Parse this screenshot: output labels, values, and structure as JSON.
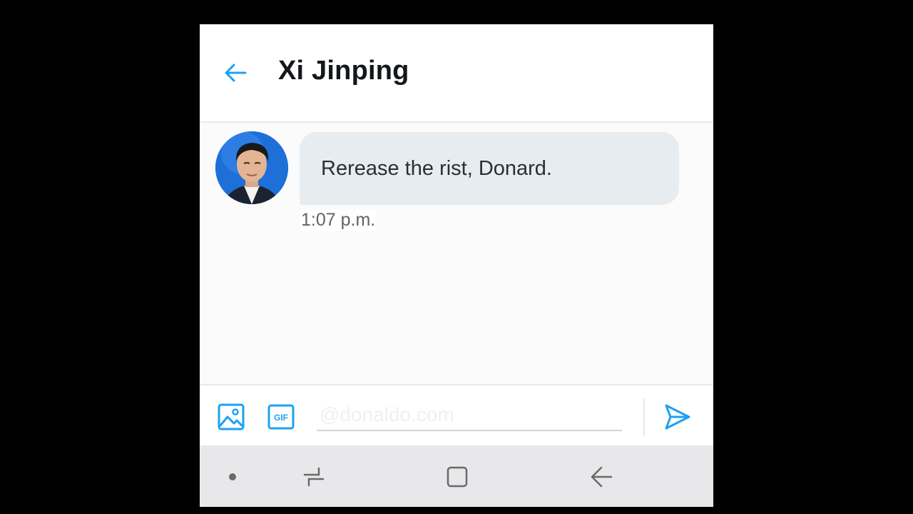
{
  "header": {
    "title": "Xi Jinping",
    "back_icon": "arrow-left-icon"
  },
  "conversation": {
    "messages": [
      {
        "text": "Rerease the rist, Donard.",
        "time": "1:07 p.m."
      }
    ]
  },
  "composer": {
    "placeholder": "@donaldo.com",
    "value": "",
    "gif_label": "GIF",
    "icons": [
      "image-icon",
      "gif-icon",
      "send-icon"
    ]
  },
  "navbar": {
    "icons": [
      "dot-icon",
      "recents-icon",
      "home-icon",
      "back-icon"
    ]
  },
  "colors": {
    "accent": "#1da1f2",
    "bubble": "#e6ecf0",
    "navbar": "#e8e8ea"
  }
}
